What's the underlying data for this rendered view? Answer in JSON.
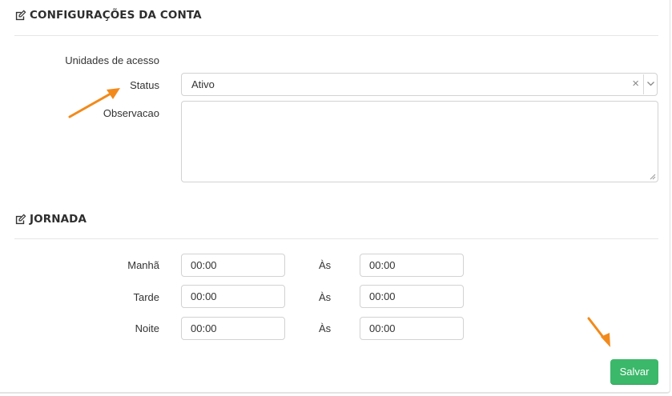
{
  "account_section": {
    "title": "CONFIGURAÇÕES DA CONTA",
    "units_label": "Unidades de acesso",
    "status_label": "Status",
    "status_value": "Ativo",
    "clear_symbol": "×",
    "observation_label": "Observacao",
    "observation_value": ""
  },
  "schedule_section": {
    "title": "JORNADA",
    "to_label": "Às",
    "rows": [
      {
        "label": "Manhã",
        "start": "00:00",
        "end": "00:00"
      },
      {
        "label": "Tarde",
        "start": "00:00",
        "end": "00:00"
      },
      {
        "label": "Noite",
        "start": "00:00",
        "end": "00:00"
      }
    ]
  },
  "actions": {
    "save_label": "Salvar"
  },
  "colors": {
    "accent_green": "#3bb86a",
    "annotation_arrow": "#f28a1b"
  }
}
